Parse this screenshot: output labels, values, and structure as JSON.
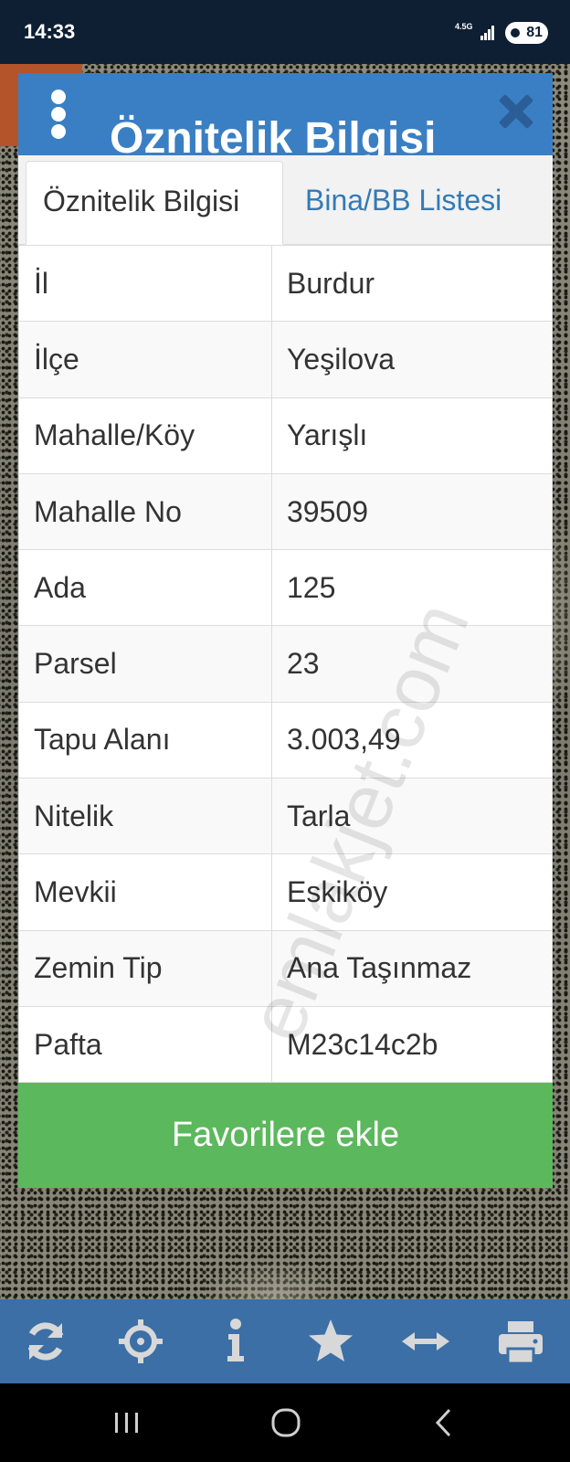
{
  "status_bar": {
    "time": "14:33",
    "network": "4.5G",
    "battery": "81"
  },
  "popup": {
    "title": "Öznitelik Bilgisi",
    "tabs": [
      {
        "label": "Öznitelik Bilgisi",
        "active": true
      },
      {
        "label": "Bina/BB Listesi",
        "active": false
      }
    ],
    "rows": [
      {
        "key": "İl",
        "value": "Burdur"
      },
      {
        "key": "İlçe",
        "value": "Yeşilova"
      },
      {
        "key": "Mahalle/Köy",
        "value": "Yarışlı"
      },
      {
        "key": "Mahalle No",
        "value": "39509"
      },
      {
        "key": "Ada",
        "value": "125"
      },
      {
        "key": "Parsel",
        "value": "23"
      },
      {
        "key": "Tapu Alanı",
        "value": "3.003,49"
      },
      {
        "key": "Nitelik",
        "value": "Tarla"
      },
      {
        "key": "Mevkii",
        "value": "Eskiköy"
      },
      {
        "key": "Zemin Tip",
        "value": "Ana Taşınmaz"
      },
      {
        "key": "Pafta",
        "value": "M23c14c2b"
      }
    ],
    "favorite_label": "Favorilere ekle",
    "watermark": "emlakjet.com"
  },
  "toolbar": {
    "items": [
      "refresh-icon",
      "locate-icon",
      "info-icon",
      "star-icon",
      "measure-icon",
      "print-icon"
    ]
  },
  "colors": {
    "header": "#3a7fc3",
    "tab_link": "#337ab7",
    "favorite": "#5cb85c",
    "toolbar": "#3b6fa6"
  }
}
